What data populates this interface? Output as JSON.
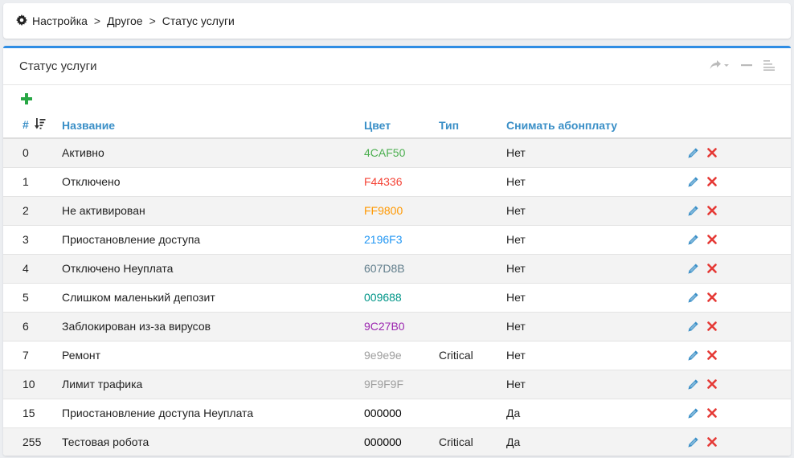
{
  "breadcrumb": {
    "items": [
      "Настройка",
      "Другое",
      "Статус услуги"
    ],
    "separator": ">"
  },
  "panel": {
    "title": "Статус услуги"
  },
  "table": {
    "headers": {
      "id": "#",
      "name": "Название",
      "color": "Цвет",
      "type": "Тип",
      "fee": "Снимать абонплату"
    },
    "rows": [
      {
        "id": "0",
        "name": "Активно",
        "color": "4CAF50",
        "color_hex": "#4CAF50",
        "type": "",
        "fee": "Нет"
      },
      {
        "id": "1",
        "name": "Отключено",
        "color": "F44336",
        "color_hex": "#F44336",
        "type": "",
        "fee": "Нет"
      },
      {
        "id": "2",
        "name": "Не активирован",
        "color": "FF9800",
        "color_hex": "#FF9800",
        "type": "",
        "fee": "Нет"
      },
      {
        "id": "3",
        "name": "Приостановление доступа",
        "color": "2196F3",
        "color_hex": "#2196F3",
        "type": "",
        "fee": "Нет"
      },
      {
        "id": "4",
        "name": "Отключено Неуплата",
        "color": "607D8B",
        "color_hex": "#607D8B",
        "type": "",
        "fee": "Нет"
      },
      {
        "id": "5",
        "name": "Слишком маленький депозит",
        "color": "009688",
        "color_hex": "#009688",
        "type": "",
        "fee": "Нет"
      },
      {
        "id": "6",
        "name": "Заблокирован из-за вирусов",
        "color": "9C27B0",
        "color_hex": "#9C27B0",
        "type": "",
        "fee": "Нет"
      },
      {
        "id": "7",
        "name": "Ремонт",
        "color": "9e9e9e",
        "color_hex": "#9e9e9e",
        "type": "Critical",
        "fee": "Нет"
      },
      {
        "id": "10",
        "name": "Лимит трафика",
        "color": "9F9F9F",
        "color_hex": "#9F9F9F",
        "type": "",
        "fee": "Нет"
      },
      {
        "id": "15",
        "name": "Приостановление доступа Неуплата",
        "color": "000000",
        "color_hex": "#000000",
        "type": "",
        "fee": "Да"
      },
      {
        "id": "255",
        "name": "Тестовая робота",
        "color": "000000",
        "color_hex": "#000000",
        "type": "Critical",
        "fee": "Да"
      }
    ]
  },
  "colors": {
    "accent": "#2f8de4",
    "header_text": "#3a8fc7",
    "add_icon": "#28a745",
    "edit_icon": "#3a8fc7",
    "delete_icon": "#e53935"
  },
  "icons": {
    "breadcrumb": "gear-icon",
    "add": "plus-icon",
    "sort": "sort-desc-icon",
    "edit": "pencil-icon",
    "delete": "close-icon",
    "tools": [
      "share-icon",
      "minimize-icon",
      "list-icon"
    ]
  }
}
